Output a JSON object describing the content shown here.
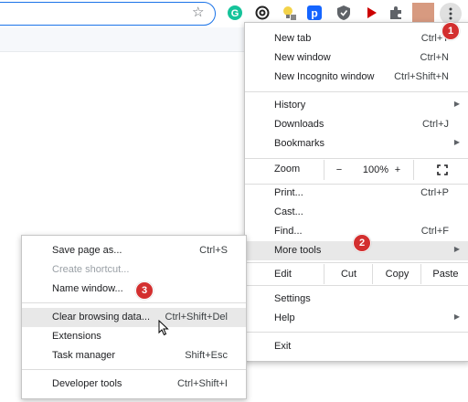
{
  "toolbar": {
    "icons": [
      "star-icon",
      "grammarly-icon",
      "extension-ring-icon",
      "lightbulb-icon",
      "pocket-p-icon",
      "shield-icon",
      "play-icon",
      "puzzle-icon"
    ],
    "avatar_color": "#d79a80"
  },
  "menu": {
    "new_tab": {
      "label": "New tab",
      "shortcut": "Ctrl+T"
    },
    "new_window": {
      "label": "New window",
      "shortcut": "Ctrl+N"
    },
    "new_incognito": {
      "label": "New Incognito window",
      "shortcut": "Ctrl+Shift+N"
    },
    "history": {
      "label": "History"
    },
    "downloads": {
      "label": "Downloads",
      "shortcut": "Ctrl+J"
    },
    "bookmarks": {
      "label": "Bookmarks"
    },
    "zoom": {
      "label": "Zoom",
      "minus": "−",
      "value": "100%",
      "plus": "+"
    },
    "print": {
      "label": "Print...",
      "shortcut": "Ctrl+P"
    },
    "cast": {
      "label": "Cast..."
    },
    "find": {
      "label": "Find...",
      "shortcut": "Ctrl+F"
    },
    "more_tools": {
      "label": "More tools"
    },
    "edit": {
      "label": "Edit",
      "cut": "Cut",
      "copy": "Copy",
      "paste": "Paste"
    },
    "settings": {
      "label": "Settings"
    },
    "help": {
      "label": "Help"
    },
    "exit": {
      "label": "Exit"
    }
  },
  "submenu": {
    "save_page": {
      "label": "Save page as...",
      "shortcut": "Ctrl+S"
    },
    "create_shortcut": {
      "label": "Create shortcut..."
    },
    "name_window": {
      "label": "Name window..."
    },
    "clear_browsing": {
      "label": "Clear browsing data...",
      "shortcut": "Ctrl+Shift+Del"
    },
    "extensions": {
      "label": "Extensions"
    },
    "task_manager": {
      "label": "Task manager",
      "shortcut": "Shift+Esc"
    },
    "developer_tools": {
      "label": "Developer tools",
      "shortcut": "Ctrl+Shift+I"
    }
  },
  "badges": {
    "one": "1",
    "two": "2",
    "three": "3"
  },
  "colors": {
    "badge": "#d32f2f",
    "accent": "#1a73e8",
    "highlight": "#e8e8e8"
  }
}
